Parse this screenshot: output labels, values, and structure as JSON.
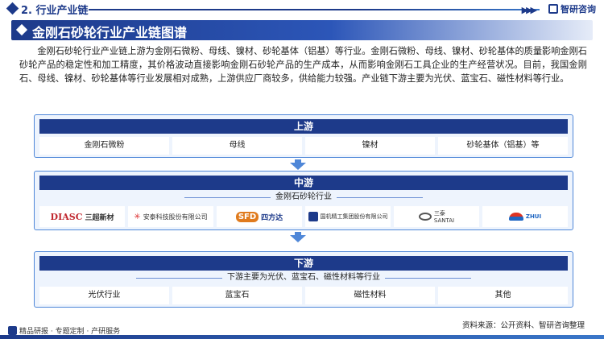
{
  "header": {
    "section_title": "2. 行业产业链",
    "brand": "智研咨询"
  },
  "title": "金刚石砂轮行业产业链图谱",
  "paragraph": "金刚石砂轮行业产业链上游为金刚石微粉、母线、镍材、砂轮基体（铝基）等行业。金刚石微粉、母线、镍材、砂轮基体的质量影响金刚石砂轮产品的稳定性和加工精度，其价格波动直接影响金刚石砂轮产品的生产成本，从而影响金刚石工具企业的生产经营状况。目前，我国金刚石、母线、镍材、砂轮基体等行业发展相对成熟，上游供应厂商较多，供给能力较强。产业链下游主要为光伏、蓝宝石、磁性材料等行业。",
  "upstream": {
    "label": "上游",
    "items": [
      "金刚石微粉",
      "母线",
      "镍材",
      "砂轮基体（铝基）等"
    ]
  },
  "midstream": {
    "label": "中游",
    "subtitle": "金刚石砂轮行业",
    "companies": [
      {
        "text": "DIASC 三超新材",
        "icon": "diasc-logo"
      },
      {
        "text": "安泰科技股份有限公司",
        "icon": "antai-logo"
      },
      {
        "text": "SFD 四方达",
        "icon": "sfd-logo"
      },
      {
        "text": "国机精工集团股份有限公司",
        "icon": "guoji-logo"
      },
      {
        "text": "三泰 SANTAI",
        "icon": "santai-logo"
      },
      {
        "text": "ZHUI",
        "icon": "zhui-logo"
      }
    ]
  },
  "downstream": {
    "label": "下游",
    "subtitle": "下游主要为光伏、蓝宝石、磁性材料等行业",
    "items": [
      "光伏行业",
      "蓝宝石",
      "磁性材料",
      "其他"
    ]
  },
  "footer": {
    "left": "精品研报 · 专题定制 · 产研服务",
    "source": "资料来源：公开资料、智研咨询整理"
  },
  "colors": {
    "navy": "#1d3a8a",
    "accent_blue": "#4f87d8",
    "panel_bg": "#eef4fd"
  }
}
